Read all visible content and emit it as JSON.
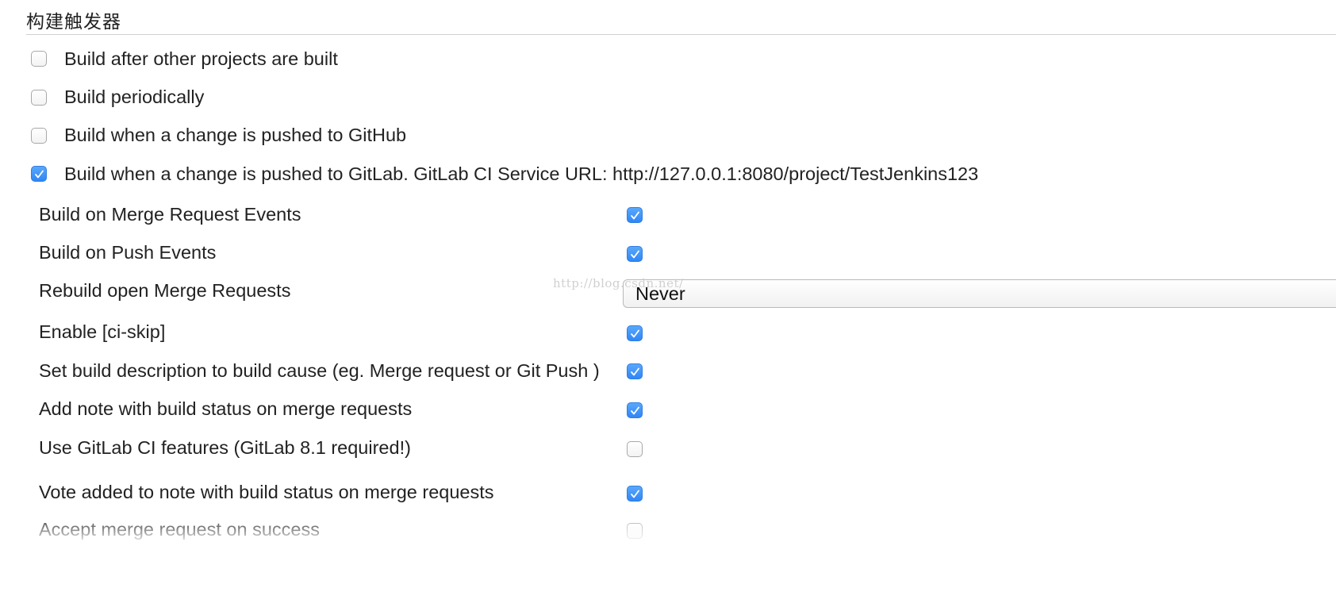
{
  "section": {
    "title": "构建触发器"
  },
  "triggers": [
    {
      "label": "Build after other projects are built",
      "checked": false
    },
    {
      "label": "Build periodically",
      "checked": false
    },
    {
      "label": "Build when a change is pushed to GitHub",
      "checked": false
    },
    {
      "label": "Build when a change is pushed to GitLab. GitLab CI Service URL: http://127.0.0.1:8080/project/TestJenkins123",
      "checked": true
    }
  ],
  "gitlab_options": {
    "merge_request_events": {
      "label": "Build on Merge Request Events",
      "checked": true
    },
    "push_events": {
      "label": "Build on Push Events",
      "checked": true
    },
    "rebuild_open_mr": {
      "label": "Rebuild open Merge Requests",
      "selected": "Never"
    },
    "ci_skip": {
      "label": "Enable [ci-skip]",
      "checked": true
    },
    "build_description": {
      "label": "Set build description to build cause (eg. Merge request or Git Push )",
      "checked": true
    },
    "add_note": {
      "label": "Add note with build status on merge requests",
      "checked": true
    },
    "gitlab_ci_features": {
      "label": "Use GitLab CI features (GitLab 8.1 required!)",
      "checked": false
    },
    "vote_added": {
      "label": "Vote added to note with build status on merge requests",
      "checked": true
    },
    "accept_mr": {
      "label": "Accept merge request on success",
      "checked": false
    }
  },
  "watermark": "http://blog.csdn.net/",
  "colors": {
    "checkbox_checked": "#2f86f6",
    "divider": "#cfcfcf"
  }
}
